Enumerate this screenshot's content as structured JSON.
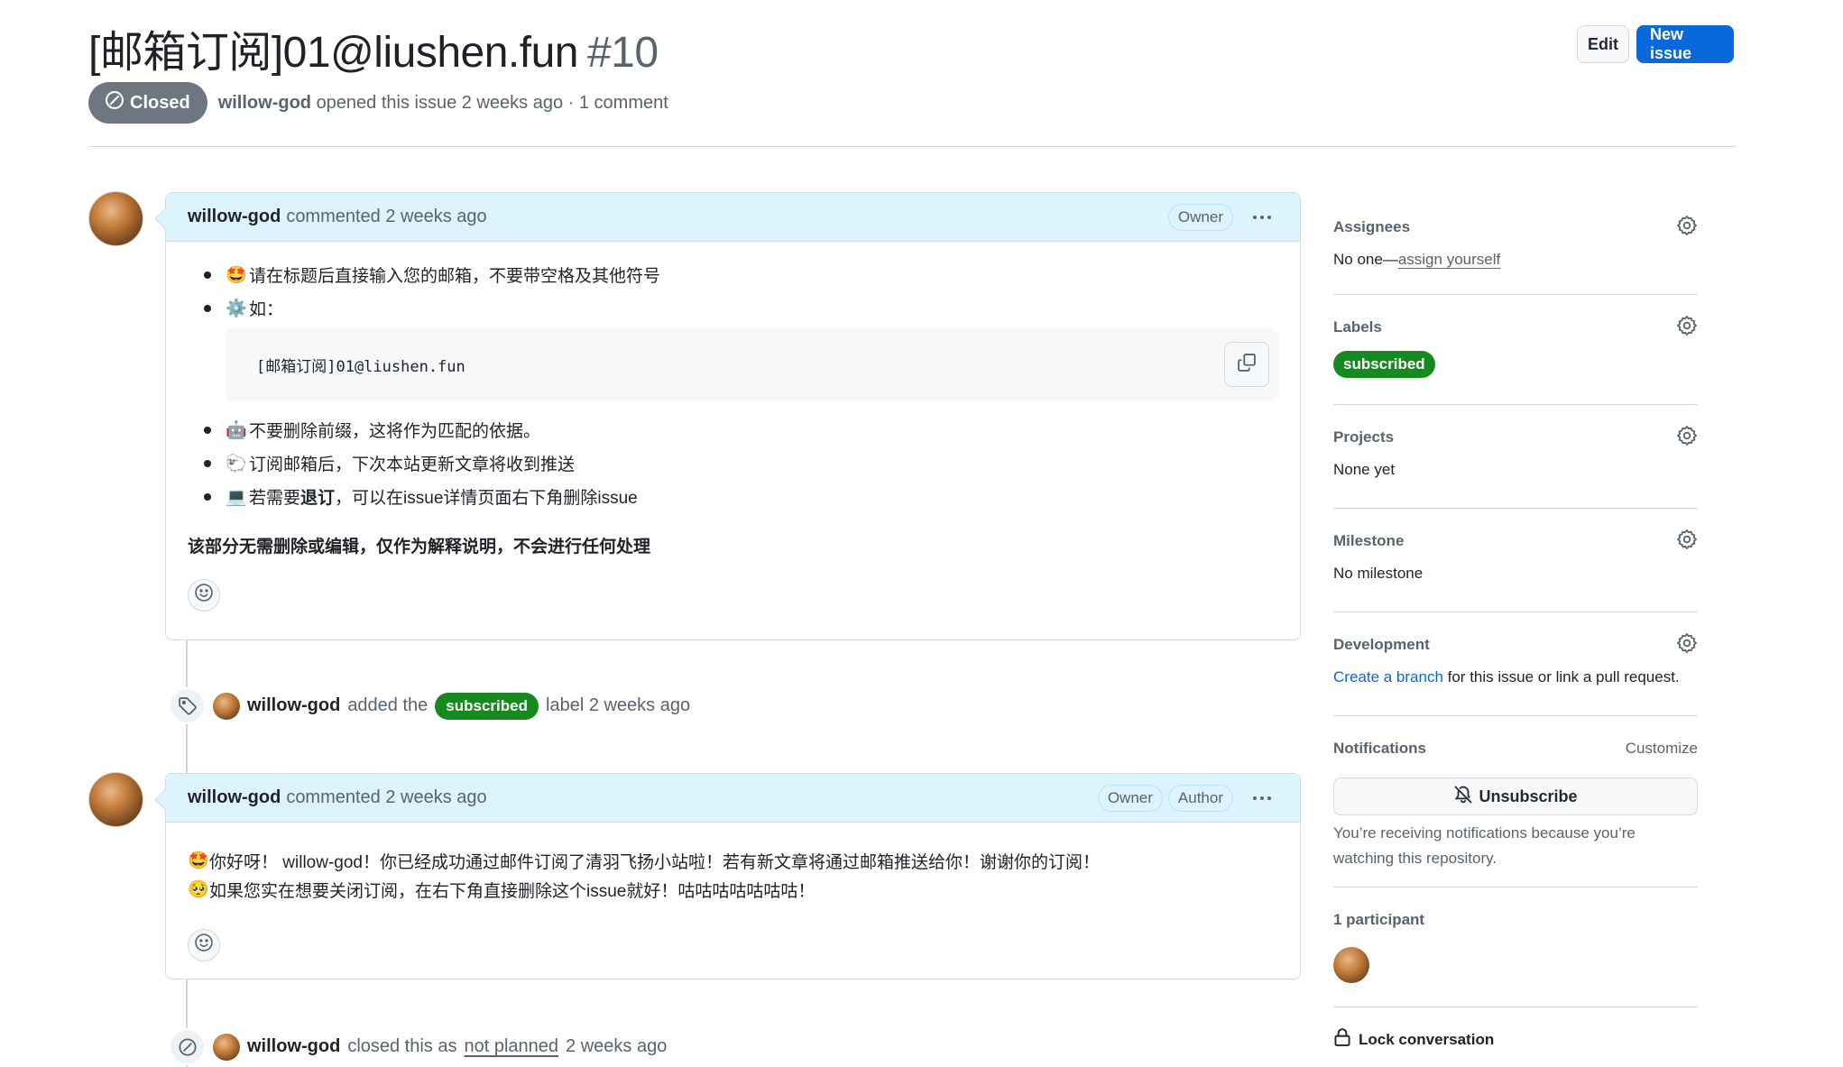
{
  "header": {
    "title": "[邮箱订阅]01@liushen.fun",
    "number": "#10",
    "edit_label": "Edit",
    "new_issue_label": "New issue",
    "state": "Closed",
    "author": "willow-god",
    "meta_rest": "opened this issue 2 weeks ago · 1 comment"
  },
  "colors": {
    "accent": "#0969da",
    "closed_badge": "#6e7781",
    "label_green": "#178a1f",
    "comment_header": "#ddf4ff"
  },
  "timeline": {
    "comment1": {
      "author": "willow-god",
      "when": "commented 2 weeks ago",
      "roles": [
        "Owner"
      ],
      "list": [
        {
          "icon": "star-struck-emoji",
          "emoji": "🤩",
          "text": "请在标题后直接输入您的邮箱，不要带空格及其他符号"
        },
        {
          "icon": "gear-emoji",
          "emoji": "⚙️",
          "text": "如："
        },
        {
          "icon": "robot-emoji",
          "emoji": "🤖",
          "text": "不要删除前缀，这将作为匹配的依据。"
        },
        {
          "icon": "sheep-emoji",
          "emoji": "🐑",
          "text": "订阅邮箱后，下次本站更新文章将收到推送"
        },
        {
          "icon": "laptop-emoji",
          "emoji": "💻",
          "text_pre": "若需要",
          "text_bold": "退订",
          "text_post": "，可以在issue详情页面右下角删除issue"
        }
      ],
      "code": "[邮箱订阅]01@liushen.fun",
      "note": "该部分无需删除或编辑，仅作为解释说明，不会进行任何处理"
    },
    "event_label": {
      "author": "willow-god",
      "pre": "added the",
      "label": "subscribed",
      "post": "label 2 weeks ago"
    },
    "comment2": {
      "author": "willow-god",
      "when": "commented 2 weeks ago",
      "roles": [
        "Owner",
        "Author"
      ],
      "lines": [
        {
          "emoji": "🤩",
          "text": "你好呀！ willow-god！你已经成功通过邮件订阅了清羽飞扬小站啦！若有新文章将通过邮箱推送给你！谢谢你的订阅！"
        },
        {
          "emoji": "🥺",
          "text": "如果您实在想要关闭订阅，在右下角直接删除这个issue就好！咕咕咕咕咕咕咕！"
        }
      ]
    },
    "event_closed": {
      "author": "willow-god",
      "pre": "closed this as",
      "reason": "not planned",
      "post": "2 weeks ago"
    }
  },
  "sidebar": {
    "assignees": {
      "title": "Assignees",
      "value_pre": "No one—",
      "value_link": "assign yourself"
    },
    "labels": {
      "title": "Labels",
      "items": [
        "subscribed"
      ]
    },
    "projects": {
      "title": "Projects",
      "value": "None yet"
    },
    "milestone": {
      "title": "Milestone",
      "value": "No milestone"
    },
    "development": {
      "title": "Development",
      "link": "Create a branch",
      "rest": " for this issue or link a pull request."
    },
    "notifications": {
      "title": "Notifications",
      "customize": "Customize",
      "button": "Unsubscribe",
      "note": "You’re receiving notifications because you’re watching this repository."
    },
    "participants": {
      "title": "1 participant",
      "count": 1
    },
    "lock": "Lock conversation"
  }
}
